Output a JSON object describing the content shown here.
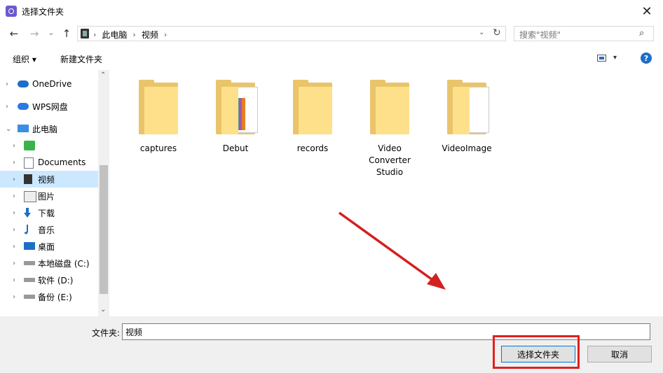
{
  "window": {
    "title": "选择文件夹",
    "close_glyph": "✕"
  },
  "nav": {
    "back_glyph": "←",
    "forward_glyph": "→",
    "recent_glyph": "⌄",
    "up_glyph": "↑"
  },
  "address": {
    "crumbs": [
      "此电脑",
      "视频"
    ],
    "separator": "›",
    "dropdown_glyph": "⌄",
    "refresh_glyph": "↻"
  },
  "search": {
    "placeholder": "搜索\"视频\"",
    "icon": "⌕"
  },
  "toolbar": {
    "organize_label": "组织 ▾",
    "new_folder_label": "新建文件夹",
    "view_dropdown": "▾",
    "help_glyph": "?"
  },
  "sidebar": {
    "items": [
      {
        "label": "OneDrive",
        "icon": "cloud-icon",
        "chevron": "›"
      },
      {
        "label": "WPS网盘",
        "icon": "wps-cloud-icon",
        "chevron": "›"
      },
      {
        "label": "此电脑",
        "icon": "computer-icon",
        "chevron": "⌄"
      },
      {
        "label": "",
        "icon": "green-app-icon",
        "chevron": "›"
      },
      {
        "label": "Documents",
        "icon": "document-icon",
        "chevron": "›"
      },
      {
        "label": "视频",
        "icon": "video-icon",
        "chevron": "›",
        "selected": true
      },
      {
        "label": "图片",
        "icon": "picture-icon",
        "chevron": "›"
      },
      {
        "label": "下载",
        "icon": "download-icon",
        "chevron": "›"
      },
      {
        "label": "音乐",
        "icon": "music-icon",
        "chevron": "›"
      },
      {
        "label": "桌面",
        "icon": "desktop-icon",
        "chevron": "›"
      },
      {
        "label": "本地磁盘 (C:)",
        "icon": "drive-icon",
        "chevron": "›"
      },
      {
        "label": "软件 (D:)",
        "icon": "drive-icon",
        "chevron": "›"
      },
      {
        "label": "备份 (E:)",
        "icon": "drive-icon",
        "chevron": "›"
      }
    ],
    "scroll_up": "⌃",
    "scroll_down": "⌄"
  },
  "folders": [
    {
      "name": "captures",
      "style": "plain"
    },
    {
      "name": "Debut",
      "style": "media"
    },
    {
      "name": "records",
      "style": "plain"
    },
    {
      "name": "Video\nConverter\nStudio",
      "style": "plain"
    },
    {
      "name": "VideoImage",
      "style": "paper"
    }
  ],
  "footer": {
    "folder_label": "文件夹:",
    "folder_value": "视频",
    "select_button": "选择文件夹",
    "cancel_button": "取消"
  },
  "colors": {
    "accent": "#0078d7",
    "highlight_red": "#e02020",
    "arrow_red": "#d42020"
  }
}
